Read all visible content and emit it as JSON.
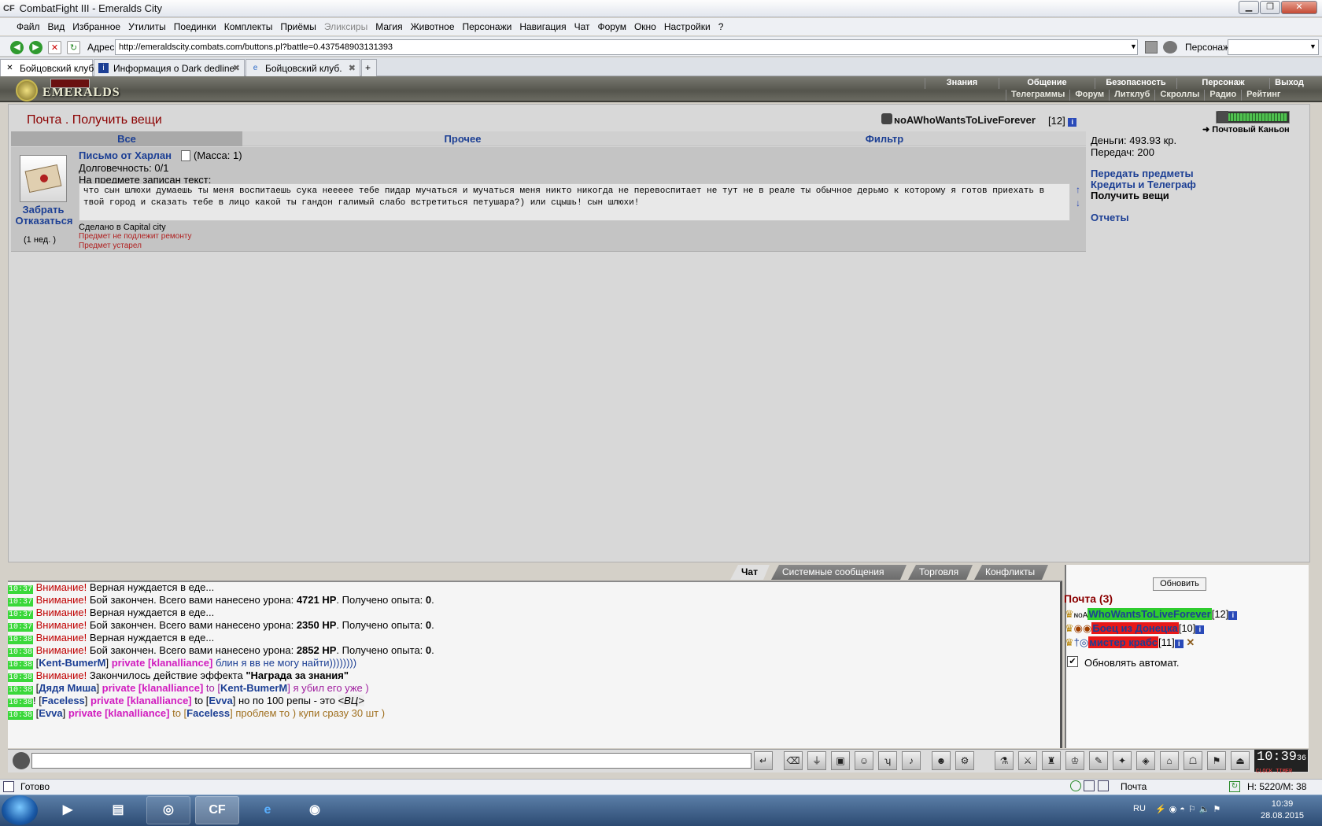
{
  "window": {
    "logo": "CF",
    "title": "CombatFight III - Emeralds City"
  },
  "menu": [
    "Файл",
    "Вид",
    "Избранное",
    "Утилиты",
    "Поединки",
    "Комплекты",
    "Приёмы",
    "Эликсиры",
    "Магия",
    "Животное",
    "Персонажи",
    "Навигация",
    "Чат",
    "Форум",
    "Окно",
    "Настройки",
    "?"
  ],
  "address": {
    "label": "Адрес:",
    "url": "http://emeraldscity.combats.com/buttons.pl?battle=0.437548903131393",
    "persona_label": "Персонаж:"
  },
  "tabs": [
    {
      "label": "Бойцовский клуб"
    },
    {
      "label": "Информация о Dark dedline"
    },
    {
      "label": "Бойцовский клуб."
    }
  ],
  "game_nav": {
    "row1": [
      "Знания",
      "Общение",
      "Безопасность",
      "Персонаж",
      "Выход"
    ],
    "row2": [
      "Телеграммы",
      "Форум",
      "Литклуб",
      "Скроллы",
      "Радио",
      "Рейтинг"
    ],
    "logo": "EMERALDS"
  },
  "mail_page": {
    "title": "Почта .  Получить вещи",
    "char_name": "ɴoAWhoWantsToLiveForever",
    "char_level": "[12]",
    "filters": [
      "Все",
      "Прочее",
      "Фильтр"
    ],
    "item": {
      "name": "Письмо от Харлан",
      "mass": "(Масса: 1)",
      "durability": "Долговечность: 0/1",
      "text_label": "На предмете записан текст:",
      "text": "что сын шлюхи думаешь ты меня воспитаешь сука неееее тебе пидар мучаться и мучаться меня никто никогда не перевоспитает не тут не в реале ты обычное дерьмо к которому я готов приехать в твой город и сказать тебе в лицо какой ты гандон галимый слабо встретиться петушара?) или сцышь! сын шлюхи!",
      "made_in": "Сделано в Capital city",
      "no_repair": "Предмет не подлежит ремонту",
      "obsolete": "Предмет устарел",
      "take": "Забрать",
      "refuse": "Отказаться",
      "age": "(1 нед. )"
    },
    "side": {
      "money": "Деньги: 493.93 кр.",
      "transfers": "Передач: 200",
      "links": [
        "Передать предметы",
        "Кредиты и Телеграф",
        "Получить вещи",
        "Отчеты"
      ],
      "location": "Почтовый Каньон"
    }
  },
  "chat": {
    "tabs": [
      "Чат",
      "Системные сообщения",
      "Торговля",
      "Конфликты"
    ],
    "lines": [
      {
        "time": "10:37",
        "warn": "Внимание!",
        "text": " Верная нуждается в еде..."
      },
      {
        "time": "10:37",
        "warn": "Внимание!",
        "text": " Бой закончен. Всего вами нанесено урона: ",
        "b1": "4721 HP",
        "t2": ". Получено опыта: ",
        "b2": "0",
        "t3": "."
      },
      {
        "time": "10:37",
        "warn": "Внимание!",
        "text": " Верная нуждается в еде..."
      },
      {
        "time": "10:37",
        "warn": "Внимание!",
        "text": " Бой закончен. Всего вами нанесено урона: ",
        "b1": "2350 HP",
        "t2": ". Получено опыта: ",
        "b2": "0",
        "t3": "."
      },
      {
        "time": "10:38",
        "warn": "Внимание!",
        "text": " Верная нуждается в еде..."
      },
      {
        "time": "10:38",
        "warn": "Внимание!",
        "text": " Бой закончен. Всего вами нанесено урона: ",
        "b1": "2852 HP",
        "t2": ". Получено опыта: ",
        "b2": "0",
        "t3": "."
      },
      {
        "time": "10:38",
        "nick": "Kent-BumerM",
        "priv": "private [klanalliance]",
        "msg": " блин я вв не могу найти))))))))"
      },
      {
        "time": "10:38",
        "warn": "Внимание!",
        "text": " Закончилось действие эффекта ",
        "b1": "\"Награда за знания\""
      },
      {
        "time": "10:38",
        "nick": "Дядя Миша",
        "priv": "private [klanalliance]",
        "to": " to [",
        "tonick": "Kent-BumerM",
        "msg": "] я убил его уже )"
      },
      {
        "time": "10:38",
        "nick": "Faceless",
        "priv": "private [klanalliance]",
        "to": " to [",
        "tonick": "Evva",
        "msg": "] но по 100 репы - это ",
        "extra": "<ВЦ>"
      },
      {
        "time": "10:38",
        "nick": "Evva",
        "priv": "private [klanalliance]",
        "to": " to [",
        "tonick": "Faceless",
        "msg": "] проблем то ) купи сразу 30 шт )"
      }
    ]
  },
  "mail_list": {
    "refresh": "Обновить",
    "title": "Почта (3)",
    "rows": [
      {
        "prefix": "ɴoA",
        "name": "WhoWantsToLiveForever",
        "level": "[12]",
        "color": "#2ecc2e"
      },
      {
        "prefix": "",
        "name": "Боец из Донецка",
        "level": "[10]",
        "color": "#e81818"
      },
      {
        "prefix": "",
        "name": "мистер крабс",
        "level": "[11]",
        "color": "#e81818"
      }
    ],
    "auto_refresh": "Обновлять автомат."
  },
  "clock": {
    "time": "10:39",
    "seconds": "36",
    "label": "CLOCK TIMER"
  },
  "status": {
    "text": "Готово",
    "page": "Почта",
    "mem": "Н: 5220/М: 38"
  },
  "taskbar": {
    "lang": "RU",
    "time": "10:39",
    "date": "28.08.2015"
  }
}
